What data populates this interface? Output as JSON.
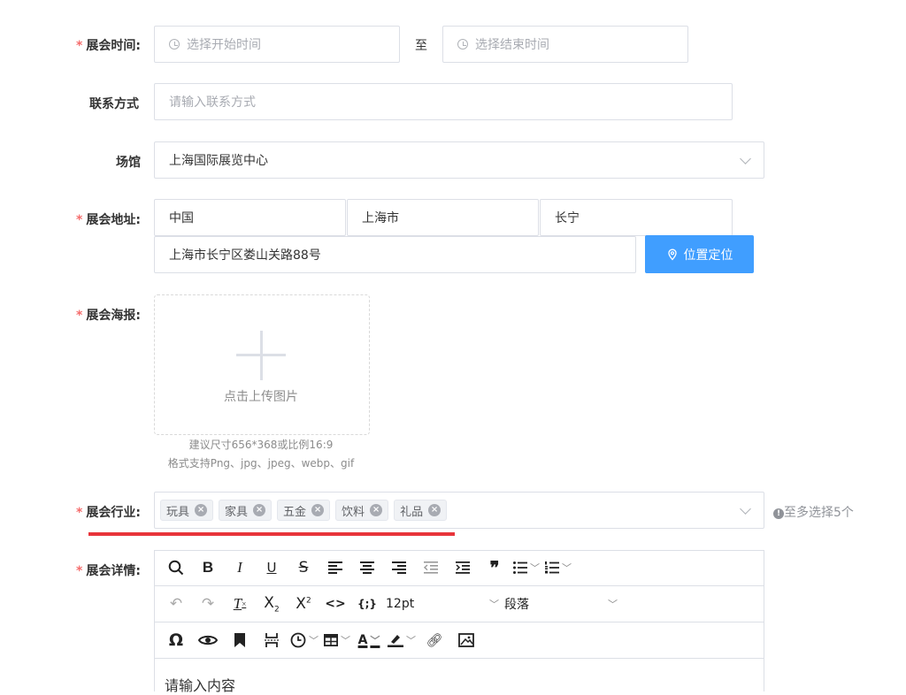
{
  "form": {
    "time": {
      "label": "展会时间:",
      "start_placeholder": "选择开始时间",
      "separator": "至",
      "end_placeholder": "选择结束时间"
    },
    "contact": {
      "label": "联系方式",
      "placeholder": "请输入联系方式"
    },
    "venue": {
      "label": "场馆",
      "value": "上海国际展览中心"
    },
    "address": {
      "label": "展会地址:",
      "country": "中国",
      "city": "上海市",
      "district": "长宁",
      "detail": "上海市长宁区娄山关路88号",
      "locate_button": "位置定位"
    },
    "poster": {
      "label": "展会海报:",
      "upload_text": "点击上传图片",
      "hint_size": "建议尺寸656*368或比例16:9",
      "hint_format": "格式支持Png、jpg、jpeg、webp、gif"
    },
    "industry": {
      "label": "展会行业:",
      "tags": [
        "玩具",
        "家具",
        "五金",
        "饮料",
        "礼品"
      ],
      "tip": "至多选择5个"
    },
    "detail": {
      "label": "展会详情:",
      "font_size": "12pt",
      "paragraph": "段落",
      "content_placeholder": "请输入内容"
    }
  },
  "colors": {
    "required": "#f56c6c",
    "primary": "#409eff",
    "highlight_underline": "#e8343a",
    "border": "#dcdfe6"
  }
}
